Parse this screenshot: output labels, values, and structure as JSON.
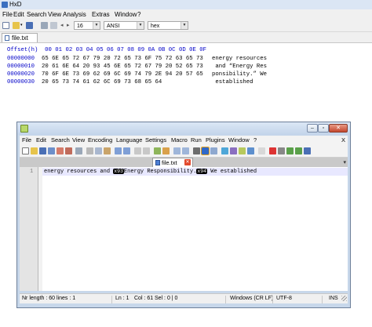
{
  "hxd": {
    "title": "HxD",
    "menu": [
      "File",
      "Edit",
      "Search",
      "View",
      "Analysis",
      "Extras",
      "Window",
      "?"
    ],
    "toolbar": {
      "bytes_per_row": "16",
      "charset": "ANSI",
      "offset_base": "hex"
    },
    "tab": "file.txt",
    "header": "Offset(h)  00 01 02 03 04 05 06 07 08 09 0A 0B 0C 0D 0E 0F",
    "rows": [
      {
        "offset": "00000000",
        "hex": "65 6E 65 72 67 79 20 72 65 73 6F 75 72 63 65 73",
        "ascii": "energy resources"
      },
      {
        "offset": "00000010",
        "hex": "20 61 6E 64 20 93 45 6E 65 72 67 79 20 52 65 73",
        "ascii": " and “Energy Res"
      },
      {
        "offset": "00000020",
        "hex": "70 6F 6E 73 69 62 69 6C 69 74 79 2E 94 20 57 65",
        "ascii": "ponsibility.” We"
      },
      {
        "offset": "00000030",
        "hex": "20 65 73 74 61 62 6C 69 73 68 65 64",
        "ascii": " established"
      }
    ]
  },
  "npp": {
    "menu": [
      "File",
      "Edit",
      "Search",
      "View",
      "Encoding",
      "Language",
      "Settings",
      "Macro",
      "Run",
      "Plugins",
      "Window",
      "?"
    ],
    "close_menu": "X",
    "tab": "file.txt",
    "line_number": "1",
    "line": {
      "before": "energy resources and ",
      "ctrl1": "x93",
      "middle": "Energy Responsibility.",
      "ctrl2": "x94",
      "after": " We established"
    },
    "status": {
      "length": "Nr length : 60",
      "lines": "lines : 1",
      "ln": "Ln : 1",
      "col": "Col : 61",
      "sel": "Sel : 0 | 0",
      "eol": "Windows (CR LF)",
      "encoding": "UTF-8",
      "mode": "INS"
    }
  }
}
